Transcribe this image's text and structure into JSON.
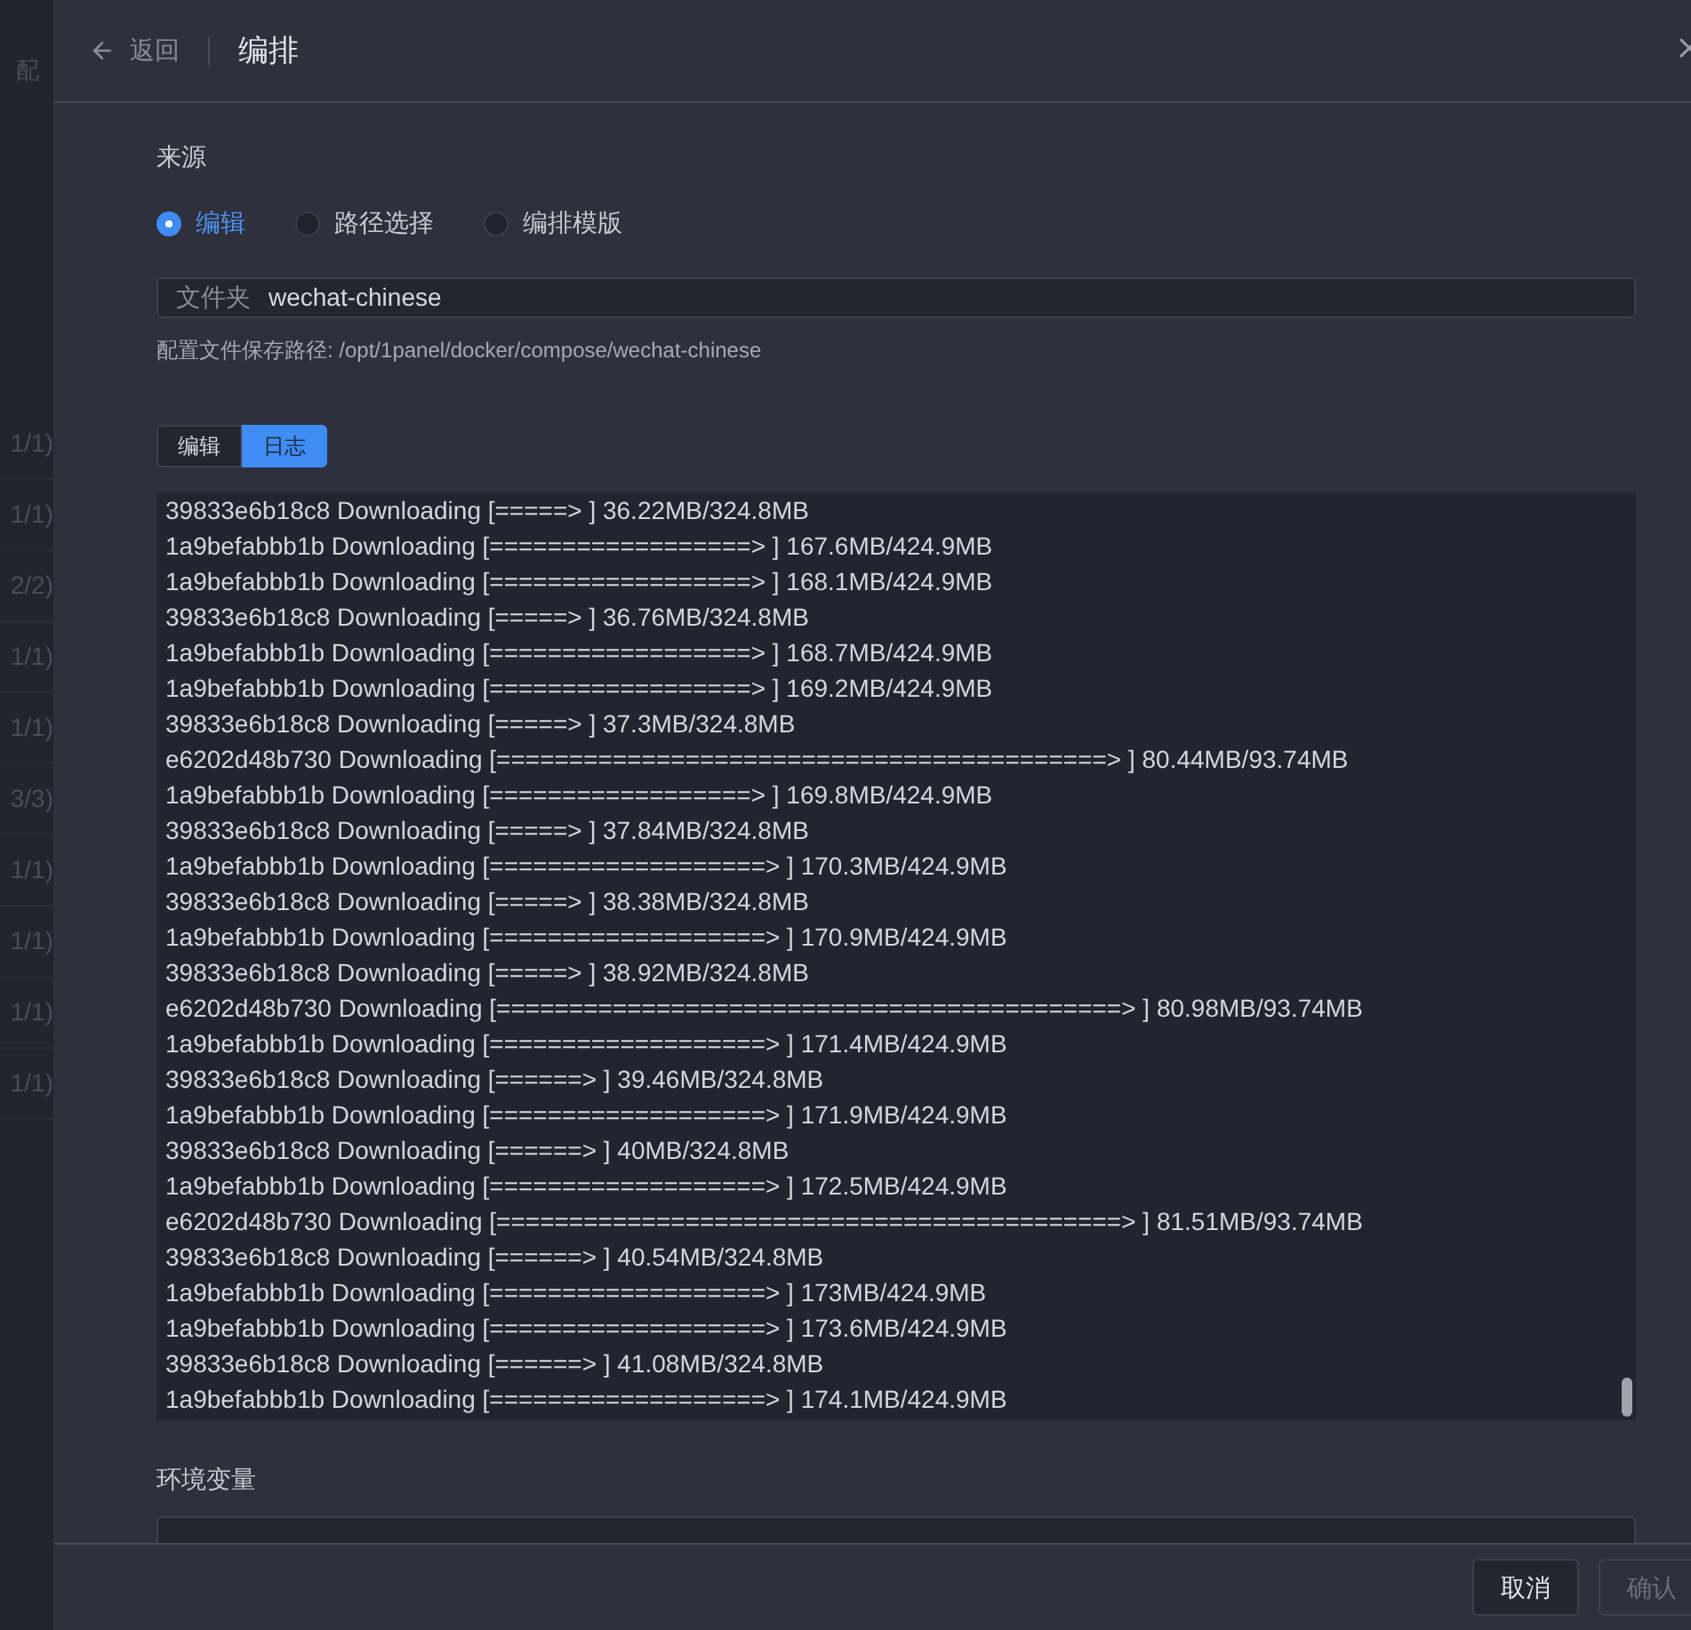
{
  "background": {
    "title": "配",
    "rows": [
      "1/1)",
      "1/1)",
      "2/2)",
      "1/1)",
      "1/1)",
      "3/3)",
      "1/1)",
      "1/1)",
      "1/1)",
      "1/1)"
    ]
  },
  "header": {
    "back": "返回",
    "title": "编排"
  },
  "source": {
    "label": "来源",
    "options": [
      {
        "label": "编辑",
        "selected": true
      },
      {
        "label": "路径选择",
        "selected": false
      },
      {
        "label": "编排模版",
        "selected": false
      }
    ]
  },
  "folder": {
    "prefix": "文件夹",
    "value": "wechat-chinese"
  },
  "path_hint": "配置文件保存路径: /opt/1panel/docker/compose/wechat-chinese",
  "tabs": [
    {
      "label": "编辑",
      "selected": false
    },
    {
      "label": "日志",
      "selected": true
    }
  ],
  "log": [
    "39833e6b18c8 Downloading [=====> ] 36.22MB/324.8MB",
    "1a9befabbb1b Downloading [==================> ] 167.6MB/424.9MB",
    "1a9befabbb1b Downloading [==================> ] 168.1MB/424.9MB",
    "39833e6b18c8 Downloading [=====> ] 36.76MB/324.8MB",
    "1a9befabbb1b Downloading [==================> ] 168.7MB/424.9MB",
    "1a9befabbb1b Downloading [==================> ] 169.2MB/424.9MB",
    "39833e6b18c8 Downloading [=====> ] 37.3MB/324.8MB",
    "e6202d48b730 Downloading [==========================================> ] 80.44MB/93.74MB",
    "1a9befabbb1b Downloading [==================> ] 169.8MB/424.9MB",
    "39833e6b18c8 Downloading [=====> ] 37.84MB/324.8MB",
    "1a9befabbb1b Downloading [===================> ] 170.3MB/424.9MB",
    "39833e6b18c8 Downloading [=====> ] 38.38MB/324.8MB",
    "1a9befabbb1b Downloading [===================> ] 170.9MB/424.9MB",
    "39833e6b18c8 Downloading [=====> ] 38.92MB/324.8MB",
    "e6202d48b730 Downloading [===========================================> ] 80.98MB/93.74MB",
    "1a9befabbb1b Downloading [===================> ] 171.4MB/424.9MB",
    "39833e6b18c8 Downloading [======> ] 39.46MB/324.8MB",
    "1a9befabbb1b Downloading [===================> ] 171.9MB/424.9MB",
    "39833e6b18c8 Downloading [======> ] 40MB/324.8MB",
    "1a9befabbb1b Downloading [===================> ] 172.5MB/424.9MB",
    "e6202d48b730 Downloading [===========================================> ] 81.51MB/93.74MB",
    "39833e6b18c8 Downloading [======> ] 40.54MB/324.8MB",
    "1a9befabbb1b Downloading [===================> ] 173MB/424.9MB",
    "1a9befabbb1b Downloading [===================> ] 173.6MB/424.9MB",
    "39833e6b18c8 Downloading [======> ] 41.08MB/324.8MB",
    "1a9befabbb1b Downloading [===================> ] 174.1MB/424.9MB"
  ],
  "env": {
    "label": "环境变量"
  },
  "footer": {
    "cancel": "取消",
    "confirm": {
      "label": "确认",
      "disabled": true
    }
  }
}
